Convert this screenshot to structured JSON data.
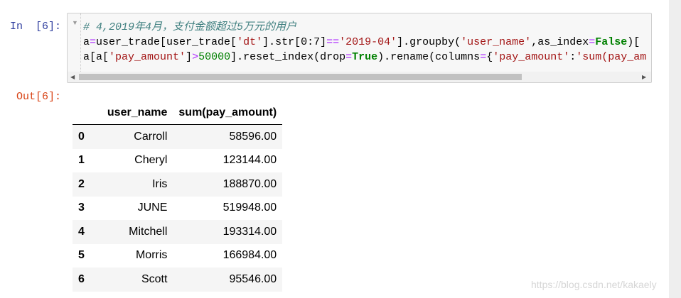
{
  "cell": {
    "in_prompt": "In  [6]:",
    "out_prompt": "Out[6]:",
    "code_lines": [
      [
        {
          "text": "# 4,2019年4月，支付金额超过5万元的用户",
          "cls": "c-comment"
        }
      ],
      [
        {
          "text": "a",
          "cls": ""
        },
        {
          "text": "=",
          "cls": "c-op"
        },
        {
          "text": "user_trade[user_trade[",
          "cls": ""
        },
        {
          "text": "'dt'",
          "cls": "c-str"
        },
        {
          "text": "].str[0:7]",
          "cls": ""
        },
        {
          "text": "==",
          "cls": "c-op"
        },
        {
          "text": "'2019-04'",
          "cls": "c-str"
        },
        {
          "text": "].groupby(",
          "cls": ""
        },
        {
          "text": "'user_name'",
          "cls": "c-str"
        },
        {
          "text": ",as_index",
          "cls": ""
        },
        {
          "text": "=",
          "cls": "c-op"
        },
        {
          "text": "False",
          "cls": "c-kw"
        },
        {
          "text": ")[",
          "cls": ""
        }
      ],
      [
        {
          "text": "a[a[",
          "cls": ""
        },
        {
          "text": "'pay_amount'",
          "cls": "c-str"
        },
        {
          "text": "]",
          "cls": ""
        },
        {
          "text": ">",
          "cls": "c-op"
        },
        {
          "text": "50000",
          "cls": "c-num"
        },
        {
          "text": "].reset_index(drop",
          "cls": ""
        },
        {
          "text": "=",
          "cls": "c-op"
        },
        {
          "text": "True",
          "cls": "c-kw"
        },
        {
          "text": ").rename(columns",
          "cls": ""
        },
        {
          "text": "=",
          "cls": "c-op"
        },
        {
          "text": "{",
          "cls": ""
        },
        {
          "text": "'pay_amount'",
          "cls": "c-str"
        },
        {
          "text": ":",
          "cls": ""
        },
        {
          "text": "'sum(pay_am",
          "cls": "c-str"
        }
      ]
    ]
  },
  "table": {
    "columns": [
      "",
      "user_name",
      "sum(pay_amount)"
    ],
    "rows": [
      [
        "0",
        "Carroll",
        "58596.00"
      ],
      [
        "1",
        "Cheryl",
        "123144.00"
      ],
      [
        "2",
        "Iris",
        "188870.00"
      ],
      [
        "3",
        "JUNE",
        "519948.00"
      ],
      [
        "4",
        "Mitchell",
        "193314.00"
      ],
      [
        "5",
        "Morris",
        "166984.00"
      ],
      [
        "6",
        "Scott",
        "95546.00"
      ]
    ]
  },
  "watermark": "https://blog.csdn.net/kakaely",
  "icons": {
    "collapse": "collapse-triangle-icon",
    "scroll_left": "scroll-left-arrow-icon",
    "scroll_right": "scroll-right-arrow-icon"
  }
}
